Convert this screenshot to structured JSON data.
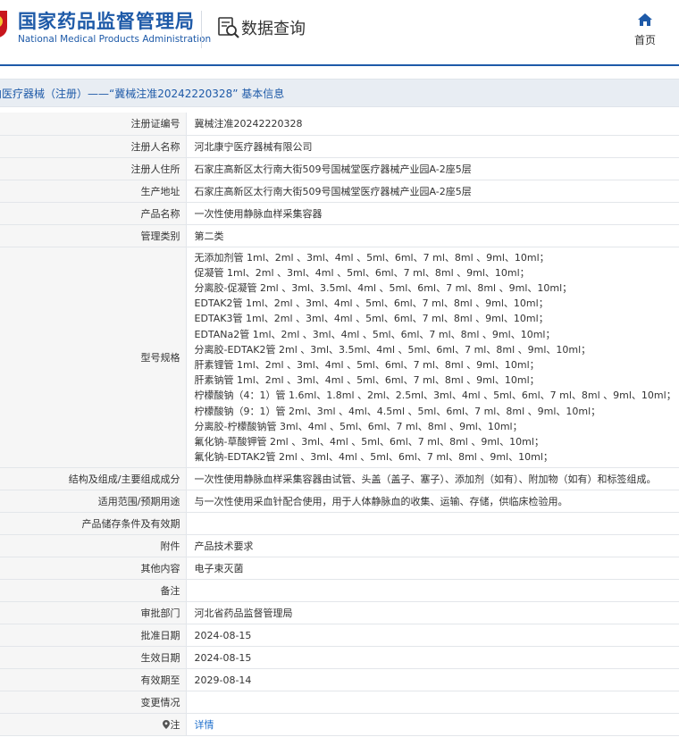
{
  "header": {
    "brand_cn": "国家药品监督管理局",
    "brand_en": "National Medical Products Administration",
    "query_label": "数据查询",
    "home_label": "首页",
    "brand_color": "#1e5aa8"
  },
  "title": "内医疗器械（注册）——“冀械注准20242220328” 基本信息",
  "rows": {
    "reg_no": {
      "key": "注册证编号",
      "value": "冀械注准20242220328"
    },
    "registrant": {
      "key": "注册人名称",
      "value": "河北康宁医疗器械有限公司"
    },
    "registrant_addr": {
      "key": "注册人住所",
      "value": "石家庄高新区太行南大街509号国械堂医疗器械产业园A-2座5层"
    },
    "production_addr": {
      "key": "生产地址",
      "value": "石家庄高新区太行南大街509号国械堂医疗器械产业园A-2座5层"
    },
    "product_name": {
      "key": "产品名称",
      "value": "一次性使用静脉血样采集容器"
    },
    "category": {
      "key": "管理类别",
      "value": "第二类"
    },
    "model": {
      "key": "型号规格",
      "lines": [
        "无添加剂管 1ml、2ml 、3ml、4ml 、5ml、6ml、7 ml、8ml 、9ml、10ml；",
        "促凝管 1ml、2ml 、3ml、4ml 、5ml、6ml、7 ml、8ml 、9ml、10ml；",
        "分离胶-促凝管 2ml 、3ml、3.5ml、4ml 、5ml、6ml、7 ml、8ml 、9ml、10ml；",
        "EDTAK2管 1ml、2ml 、3ml、4ml 、5ml、6ml、7 ml、8ml 、9ml、10ml；",
        "EDTAK3管 1ml、2ml 、3ml、4ml 、5ml、6ml、7 ml、8ml 、9ml、10ml；",
        "EDTANa2管 1ml、2ml 、3ml、4ml 、5ml、6ml、7 ml、8ml 、9ml、10ml；",
        "分离胶-EDTAK2管 2ml 、3ml、3.5ml、4ml 、5ml、6ml、7 ml、8ml 、9ml、10ml；",
        "肝素锂管 1ml、2ml 、3ml、4ml 、5ml、6ml、7 ml、8ml 、9ml、10ml；",
        "肝素钠管 1ml、2ml 、3ml、4ml 、5ml、6ml、7 ml、8ml 、9ml、10ml；",
        "柠檬酸钠（4：1）管 1.6ml、1.8ml 、2ml、2.5ml、3ml、4ml 、5ml、6ml、7 ml、8ml 、9ml、10ml；",
        "柠檬酸钠（9：1）管 2ml、3ml 、4ml、4.5ml 、5ml、6ml、7 ml、8ml 、9ml、10ml；",
        "分离胶-柠檬酸钠管 3ml、4ml 、5ml、6ml、7 ml、8ml 、9ml、10ml；",
        "氟化钠-草酸钾管 2ml 、3ml、4ml 、5ml、6ml、7 ml、8ml 、9ml、10ml；",
        "氟化钠-EDTAK2管 2ml 、3ml、4ml 、5ml、6ml、7 ml、8ml 、9ml、10ml；"
      ]
    },
    "structure": {
      "key": "结构及组成/主要组成成分",
      "value": "一次性使用静脉血样采集容器由试管、头盖（盖子、塞子）、添加剂（如有）、附加物（如有）和标签组成。"
    },
    "scope": {
      "key": "适用范围/预期用途",
      "value": "与一次性使用采血针配合使用，用于人体静脉血的收集、运输、存储，供临床检验用。"
    },
    "storage": {
      "key": "产品储存条件及有效期",
      "value": ""
    },
    "attachment": {
      "key": "附件",
      "value": "产品技术要求"
    },
    "other": {
      "key": "其他内容",
      "value": "电子束灭菌"
    },
    "remark": {
      "key": "备注",
      "value": ""
    },
    "approval_dept": {
      "key": "审批部门",
      "value": "河北省药品监督管理局"
    },
    "approval_date": {
      "key": "批准日期",
      "value": "2024-08-15"
    },
    "effective_date": {
      "key": "生效日期",
      "value": "2024-08-15"
    },
    "expiry_date": {
      "key": "有效期至",
      "value": "2029-08-14"
    },
    "change": {
      "key": "变更情况",
      "value": ""
    },
    "note": {
      "key": "注",
      "value": "详情",
      "icon": "location-pin-icon"
    }
  }
}
